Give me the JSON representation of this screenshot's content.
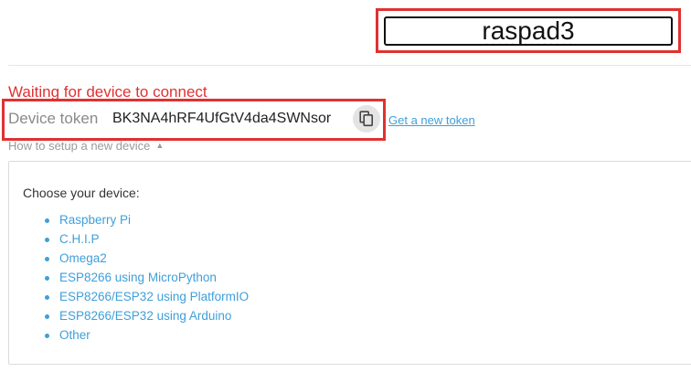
{
  "device_name": {
    "value": "raspad3"
  },
  "status": {
    "text": "Waiting for device to connect"
  },
  "token": {
    "label": "Device token",
    "value": "BK3NA4hRF4UfGtV4da4SWNsor",
    "new_token_link": "Get a new token"
  },
  "setup": {
    "toggle_label": "How to setup a new device",
    "choose_label": "Choose your device:",
    "devices": [
      "Raspberry Pi",
      "C.H.I.P",
      "Omega2",
      "ESP8266 using MicroPython",
      "ESP8266/ESP32 using PlatformIO",
      "ESP8266/ESP32 using Arduino",
      "Other"
    ]
  },
  "colors": {
    "highlight_red": "#e03131",
    "link_blue": "#3f9fd9",
    "status_red": "#e03131"
  },
  "icons": {
    "copy": "copy-icon",
    "caret": "caret-up-icon"
  }
}
